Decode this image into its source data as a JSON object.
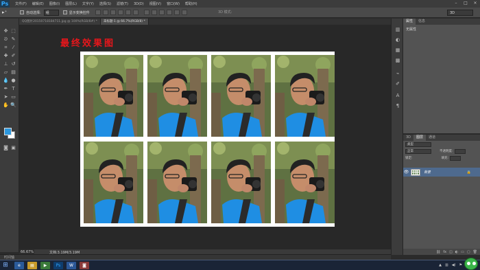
{
  "app": {
    "logo": "Ps"
  },
  "menu": [
    "文件(F)",
    "编辑(E)",
    "图像(I)",
    "图层(L)",
    "文字(Y)",
    "选择(S)",
    "滤镜(T)",
    "3D(D)",
    "视图(V)",
    "窗口(W)",
    "帮助(H)"
  ],
  "options_bar": {
    "auto_select_label": "自动选择:",
    "auto_select_value": "组",
    "transform_label": "显示变换控件",
    "mode_3d_label": "3D 模式:",
    "workspace": "3D"
  },
  "tabs": [
    {
      "label": "QQ图片20150718184711.jpg @ 100%(RGB/8#) *",
      "active": false
    },
    {
      "label": "未标题-1 @ 66.7%(RGB/8) *",
      "active": true
    }
  ],
  "canvas": {
    "title": "最终效果图"
  },
  "status": {
    "zoom": "66.67%",
    "doc": "文档:3.19M/3.19M"
  },
  "timeline": {
    "label": "时间轴"
  },
  "properties_panel": {
    "tabs": [
      "属性",
      "信息"
    ],
    "body": "无属性"
  },
  "layers_panel": {
    "tabs": [
      "3D",
      "图层",
      "通道"
    ],
    "kind": "类型",
    "blend_mode": "正常",
    "opacity_label": "不透明度:",
    "lock_label": "锁定:",
    "fill_label": "填充:",
    "layers": [
      {
        "name": "背景",
        "visible": true,
        "locked": true
      }
    ]
  },
  "colors": {
    "foreground": "#2c97dd",
    "background": "#ffffff",
    "title_red": "#e8161b"
  }
}
